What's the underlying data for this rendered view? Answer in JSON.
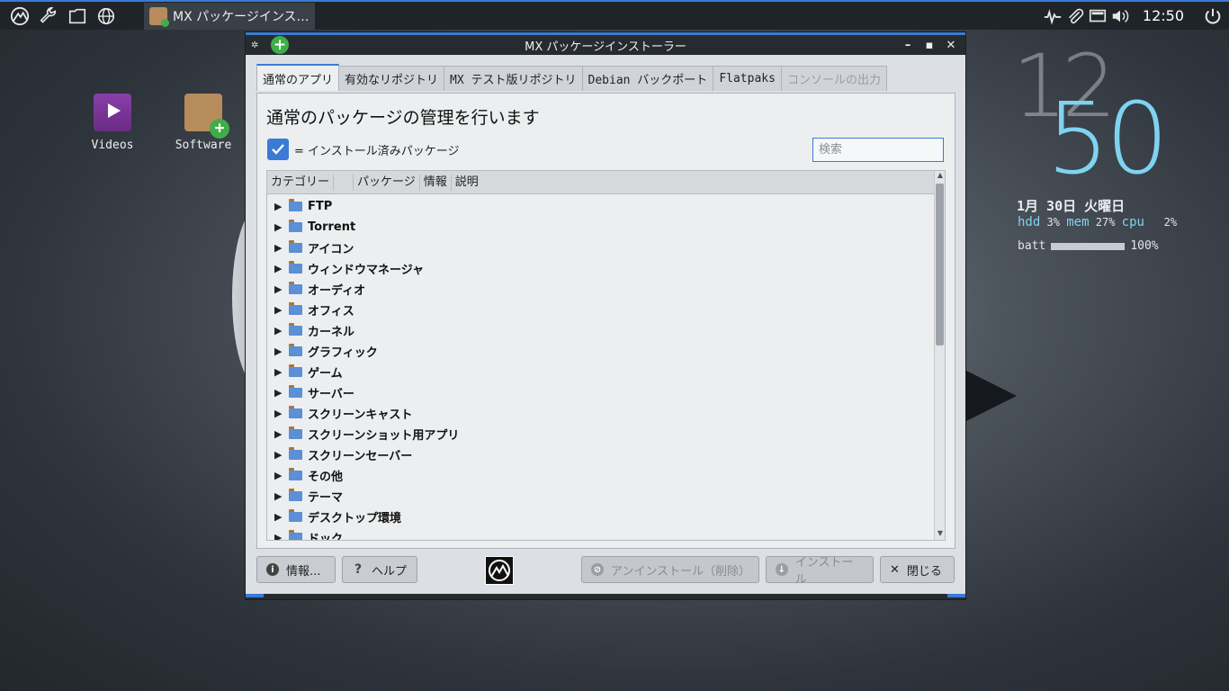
{
  "panel": {
    "task_title": "MX パッケージインス…",
    "clock": "12:50"
  },
  "desktop": {
    "icons": [
      {
        "label": "Videos"
      },
      {
        "label": "Software"
      }
    ]
  },
  "conky": {
    "hour": "12",
    "minute": "50",
    "date": "1月 30日 火曜日",
    "hdd_label": "hdd",
    "hdd_value": "3%",
    "mem_label": "mem",
    "mem_value": "27%",
    "cpu_label": "cpu",
    "cpu_value": "2%",
    "batt_label": "batt",
    "batt_value": "100%",
    "batt_level": 1.0
  },
  "window": {
    "title": "MX パッケージインストーラー",
    "tabs": [
      {
        "label": "通常のアプリ",
        "active": true
      },
      {
        "label": "有効なリポジトリ"
      },
      {
        "label": "MX テスト版リポジトリ"
      },
      {
        "label": "Debian バックポート"
      },
      {
        "label": "Flatpaks"
      },
      {
        "label": "コンソールの出力",
        "disabled": true
      }
    ],
    "heading": "通常のパッケージの管理を行います",
    "legend_text": "= インストール済みパッケージ",
    "search_placeholder": "検索",
    "columns": [
      "カテゴリー",
      "",
      "パッケージ",
      "情報",
      "説明"
    ],
    "categories": [
      "FTP",
      "Torrent",
      "アイコン",
      "ウィンドウマネージャ",
      "オーディオ",
      "オフィス",
      "カーネル",
      "グラフィック",
      "ゲーム",
      "サーバー",
      "スクリーンキャスト",
      "スクリーンショット用アプリ",
      "スクリーンセーバー",
      "その他",
      "テーマ",
      "デスクトップ環境",
      "ドック"
    ],
    "buttons": {
      "info": "情報...",
      "help": "ヘルプ",
      "uninstall": "アンインストール（削除）",
      "install": "インストール",
      "close": "閉じる"
    }
  }
}
